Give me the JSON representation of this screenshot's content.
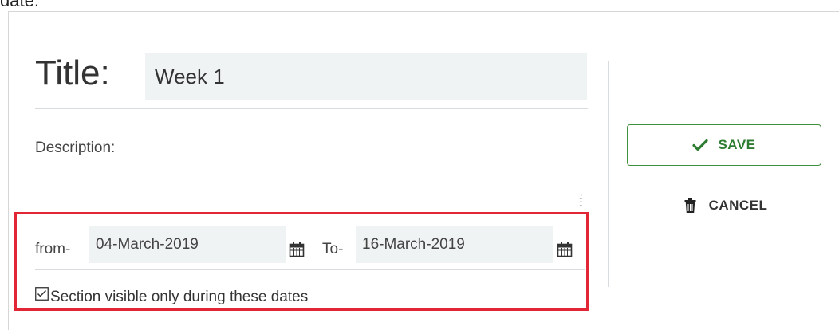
{
  "top_caption": "date.",
  "form": {
    "title_label": "Title:",
    "title_value": "Week 1",
    "description_label": "Description:",
    "description_value": "",
    "dates": {
      "from_label": "from-",
      "from_value": "04-March-2019",
      "to_label": "To-",
      "to_value": "16-March-2019",
      "visible_checkbox_label": "Section visible only during these dates",
      "visible_checked": true
    }
  },
  "actions": {
    "save_label": "SAVE",
    "cancel_label": "CANCEL"
  },
  "colors": {
    "save_accent": "#2e7d32",
    "highlight": "#e32636",
    "input_bg": "#f0f3f4"
  },
  "icons": {
    "save": "check-icon",
    "cancel": "trash-icon",
    "date_picker": "calendar-icon",
    "resize": "resize-grip-icon"
  }
}
